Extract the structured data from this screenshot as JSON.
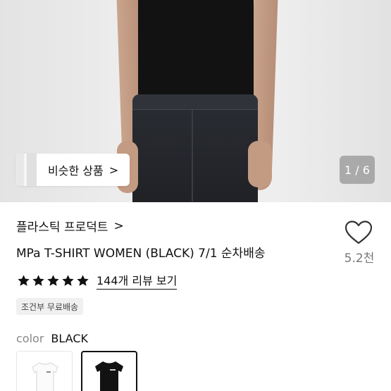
{
  "hero": {
    "similar_label": "비슷한 상품",
    "similar_chevron": ">",
    "counter": "1 / 6"
  },
  "product": {
    "brand": "플라스틱 프로덕트",
    "brand_chevron": ">",
    "title": "MPa T-SHIRT WOMEN (BLACK) 7/1 순차배송",
    "likes": "5.2천",
    "rating": 5,
    "reviews_link": "144개 리뷰 보기",
    "shipping_badge": "조건부 무료배송",
    "color_key": "color",
    "color_value": "BLACK",
    "options": [
      {
        "name": "white",
        "color": "#ffffff",
        "selected": false
      },
      {
        "name": "black",
        "color": "#111111",
        "selected": true
      }
    ]
  },
  "icons": {
    "heart": "heart-icon",
    "star": "star-icon"
  }
}
